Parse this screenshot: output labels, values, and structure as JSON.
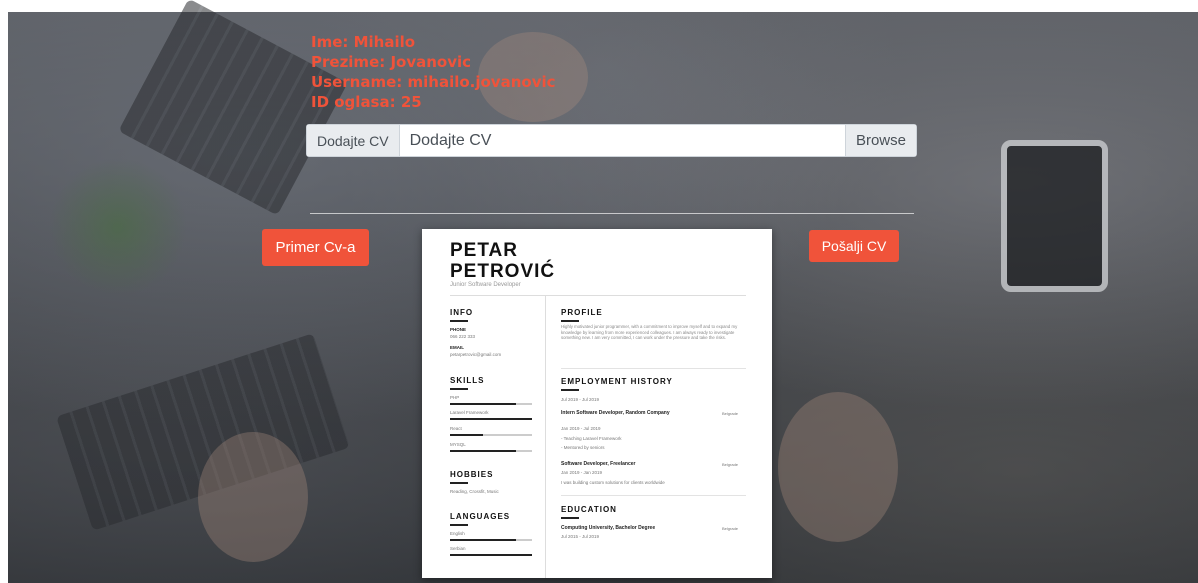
{
  "applicant": {
    "ime": "Ime: Mihailo",
    "prezime": "Prezime: Jovanovic",
    "username": "Username: mihailo.jovanovic",
    "id_oglasa": "ID oglasa: 25"
  },
  "file_upload": {
    "prefix_label": "Dodajte CV",
    "placeholder": "Dodajte CV",
    "browse_label": "Browse"
  },
  "buttons": {
    "primer": "Primer Cv-a",
    "posalji": "Pošalji CV"
  },
  "colors": {
    "accent": "#f0533a"
  },
  "cv": {
    "first_name": "PETAR",
    "last_name": "PETROVIĆ",
    "role": "Junior Software Developer",
    "info": {
      "heading": "INFO",
      "phone_label": "PHONE",
      "phone": "066 222 333",
      "email_label": "EMAIL",
      "email": "petarpetrovic@gmail.com"
    },
    "skills": {
      "heading": "SKILLS",
      "items": [
        {
          "name": "PHP",
          "level": 0.8
        },
        {
          "name": "Laravel Framework",
          "level": 1.0
        },
        {
          "name": "React",
          "level": 0.4
        },
        {
          "name": "MYSQL",
          "level": 0.8
        }
      ]
    },
    "hobbies": {
      "heading": "HOBBIES",
      "text": "Reading, Crossfit, Music"
    },
    "languages": {
      "heading": "LANGUAGES",
      "items": [
        {
          "name": "English",
          "level": 0.8
        },
        {
          "name": "Serbian",
          "level": 1.0
        }
      ]
    },
    "profile": {
      "heading": "PROFILE",
      "text": "Highly motivated junior programmer, with a commitment to improve myself and to expand my knowledge by learning from more experienced colleagues. I am always ready to investigate something new. I am very committed, I can work under the pressure and take the risks."
    },
    "employment": {
      "heading": "EMPLOYMENT HISTORY",
      "period_top": "Jul 2019 - Jul 2019",
      "jobs": [
        {
          "title": "Intern Software Developer, Random Company",
          "city": "Belgrade",
          "dates": "Jan 2019 - Jul 2019",
          "bullets": [
            "- Teaching Laravel Framework",
            "- Mentored by seniors"
          ]
        },
        {
          "title": "Software Developer, Freelancer",
          "city": "Belgrade",
          "dates": "Jan 2019 - Jan 2019",
          "bullets": [
            "I was building custom solutions for clients worldwide"
          ]
        }
      ]
    },
    "education": {
      "heading": "EDUCATION",
      "title": "Computing University, Bachelor Degree",
      "city": "Belgrade",
      "dates": "Jul 2015 - Jul 2019"
    }
  }
}
